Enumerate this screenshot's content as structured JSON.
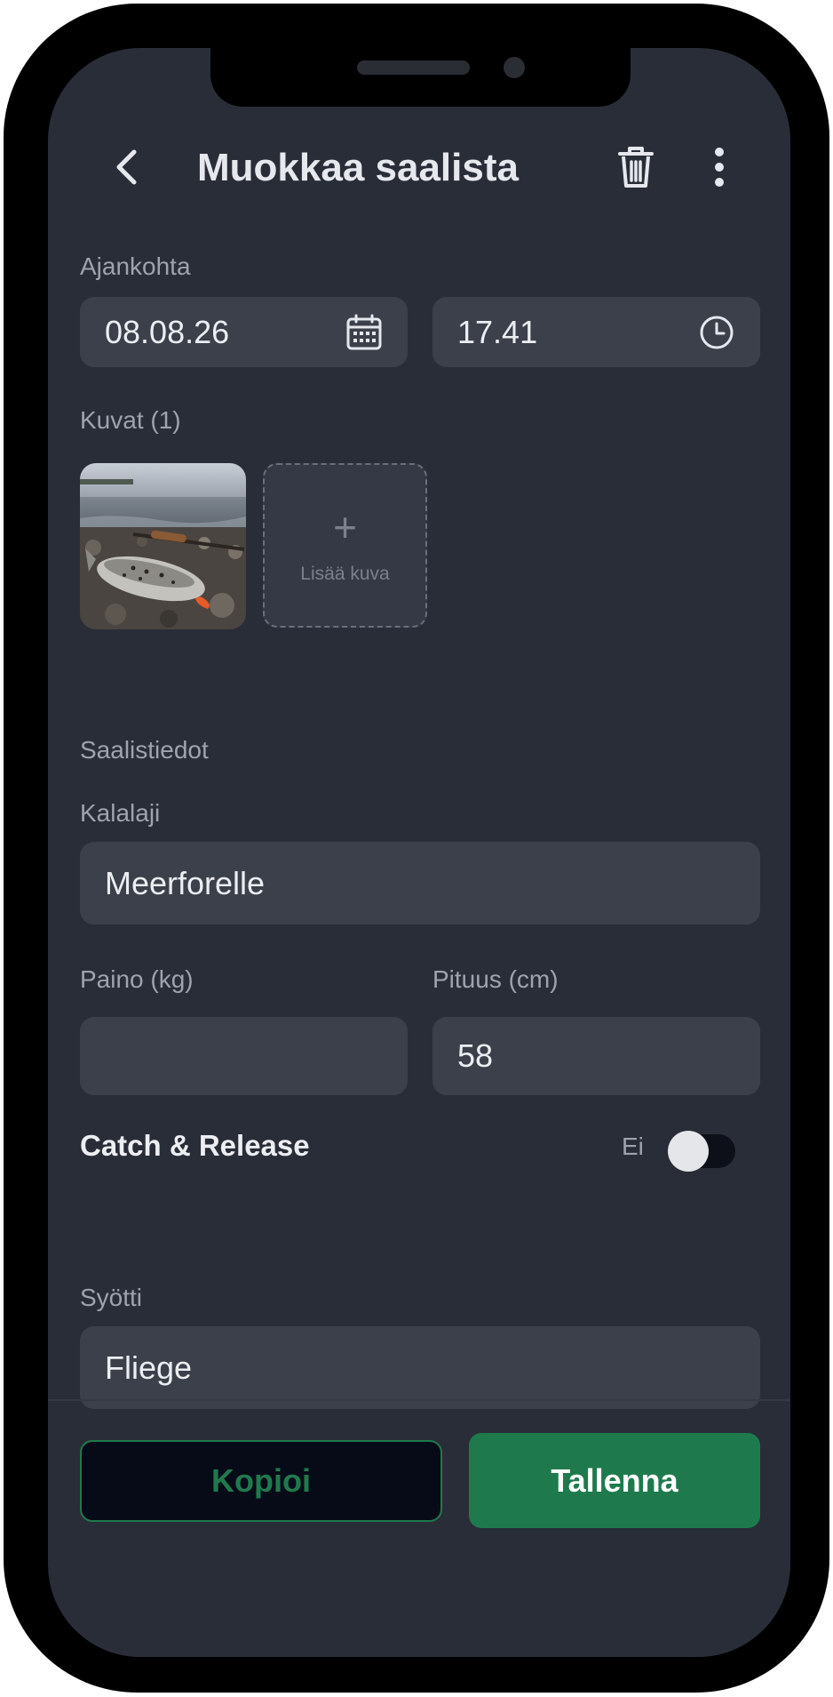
{
  "header": {
    "title": "Muokkaa saalista",
    "back_icon": "chevron-left-icon",
    "delete_icon": "trash-icon",
    "more_icon": "more-vertical-icon"
  },
  "datetime": {
    "label": "Ajankohta",
    "date_value": "08.08.26",
    "date_icon": "calendar-icon",
    "time_value": "17.41",
    "time_icon": "clock-icon"
  },
  "photos": {
    "label": "Kuvat (1)",
    "add_plus": "+",
    "add_label": "Lisää kuva"
  },
  "catch_details": {
    "section_label": "Saalistiedot",
    "species_label": "Kalalaji",
    "species_value": "Meerforelle",
    "weight_label": "Paino (kg)",
    "weight_value": "",
    "length_label": "Pituus (cm)",
    "length_value": "58",
    "catch_release_label": "Catch & Release",
    "catch_release_state": "Ei",
    "catch_release_on": false,
    "bait_label": "Syötti",
    "bait_value": "Fliege"
  },
  "actions": {
    "copy_label": "Kopioi",
    "save_label": "Tallenna"
  },
  "colors": {
    "background": "#292d38",
    "field": "#3b404b",
    "accent_green": "#1e7a4d",
    "text_primary": "#eceef2",
    "text_muted": "#9ea3ae"
  }
}
